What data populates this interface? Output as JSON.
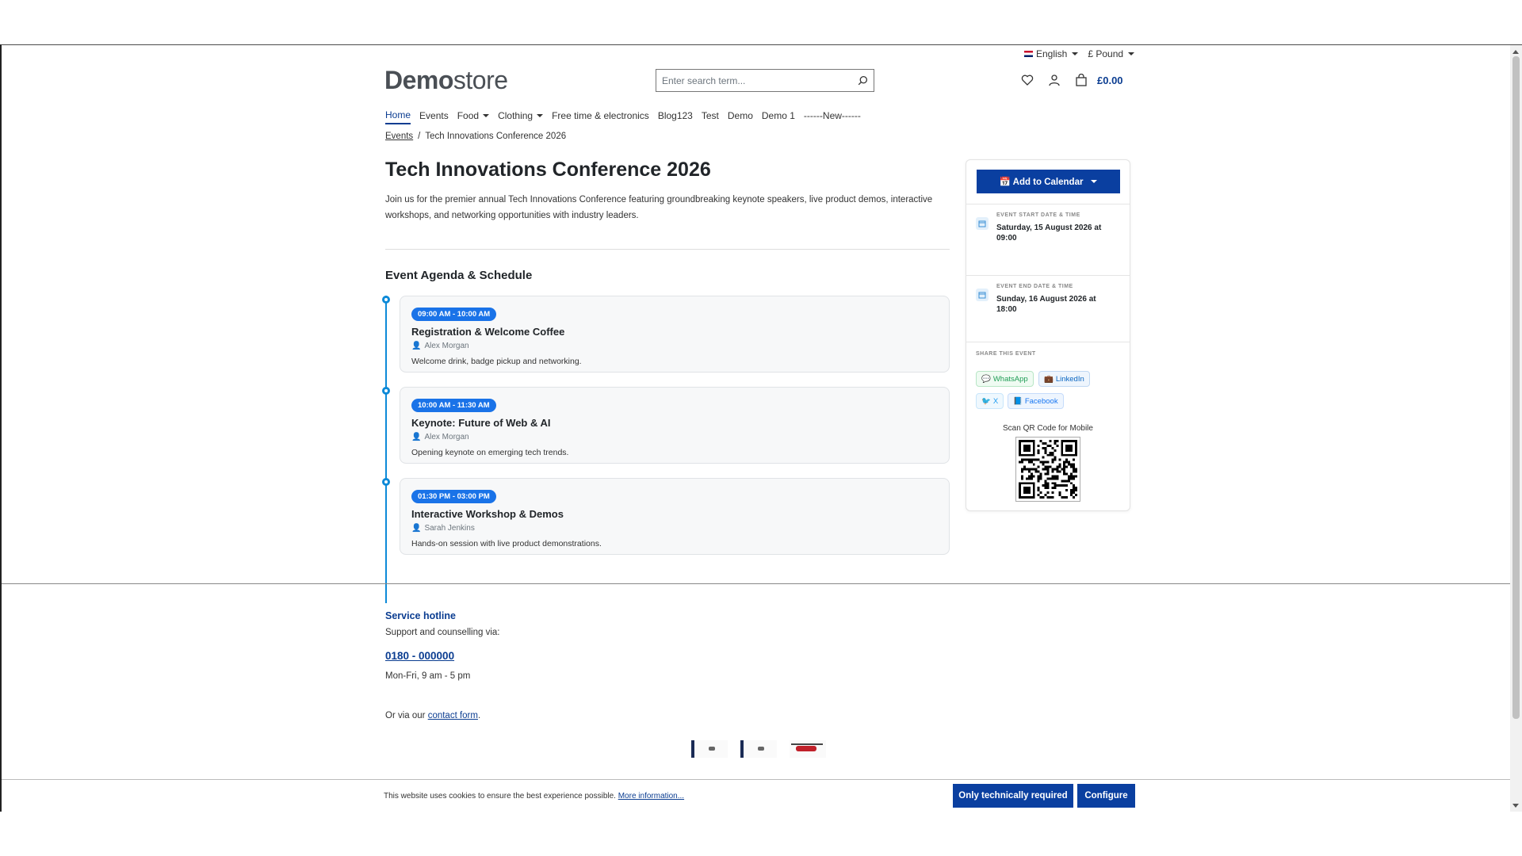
{
  "topbar": {
    "language": "English",
    "currency": "£ Pound"
  },
  "header": {
    "logo_bold": "Demo",
    "logo_light": "store",
    "search_placeholder": "Enter search term...",
    "cart_total": "£0.00"
  },
  "nav": [
    {
      "label": "Home",
      "active": true,
      "dropdown": false
    },
    {
      "label": "Events",
      "active": false,
      "dropdown": false
    },
    {
      "label": "Food",
      "active": false,
      "dropdown": true
    },
    {
      "label": "Clothing",
      "active": false,
      "dropdown": true
    },
    {
      "label": "Free time & electronics",
      "active": false,
      "dropdown": false
    },
    {
      "label": "Blog123",
      "active": false,
      "dropdown": false
    },
    {
      "label": "Test",
      "active": false,
      "dropdown": false
    },
    {
      "label": "Demo",
      "active": false,
      "dropdown": false
    },
    {
      "label": "Demo 1",
      "active": false,
      "dropdown": false
    },
    {
      "label": "------New------",
      "active": false,
      "dropdown": false
    }
  ],
  "breadcrumb": {
    "parent": "Events",
    "separator": "/",
    "current": "Tech Innovations Conference 2026"
  },
  "event": {
    "title": "Tech Innovations Conference 2026",
    "description": "Join us for the premier annual Tech Innovations Conference featuring groundbreaking keynote speakers, live product demos, interactive workshops, and networking opportunities with industry leaders."
  },
  "agenda": {
    "heading": "Event Agenda & Schedule",
    "items": [
      {
        "time": "09:00 AM - 10:00 AM",
        "title": "Registration & Welcome Coffee",
        "speaker": "Alex Morgan",
        "description": "Welcome drink, badge pickup and networking."
      },
      {
        "time": "10:00 AM - 11:30 AM",
        "title": "Keynote: Future of Web & AI",
        "speaker": "Alex Morgan",
        "description": "Opening keynote on emerging tech trends."
      },
      {
        "time": "01:30 PM - 03:00 PM",
        "title": "Interactive Workshop & Demos",
        "speaker": "Sarah Jenkins",
        "description": "Hands-on session with live product demonstrations."
      }
    ]
  },
  "sidebar": {
    "calendar_button": "📅 Add to Calendar",
    "start_label": "Event start date & time",
    "start_value": "Saturday, 15 August 2026 at 09:00",
    "end_label": "Event end date & time",
    "end_value": "Sunday, 16 August 2026 at 18:00",
    "share_label": "Share this event",
    "share": {
      "whatsapp": "WhatsApp",
      "linkedin": "LinkedIn",
      "x": "X",
      "facebook": "Facebook"
    },
    "qr_label": "Scan QR Code for Mobile"
  },
  "footer": {
    "hotline_title": "Service hotline",
    "hotline_sub": "Support and counselling via:",
    "phone": "0180 - 000000",
    "hours": "Mon-Fri, 9 am - 5 pm",
    "contact_prefix": "Or via our ",
    "contact_link": "contact form",
    "contact_suffix": "."
  },
  "cookie": {
    "text": "This website uses cookies to ensure the best experience possible. ",
    "more": "More information...",
    "required_button": "Only technically required",
    "configure_button": "Configure"
  },
  "colors": {
    "brand": "#0a3fa0",
    "timeline": "#0d8ad8",
    "pill": "#1a73e8"
  }
}
